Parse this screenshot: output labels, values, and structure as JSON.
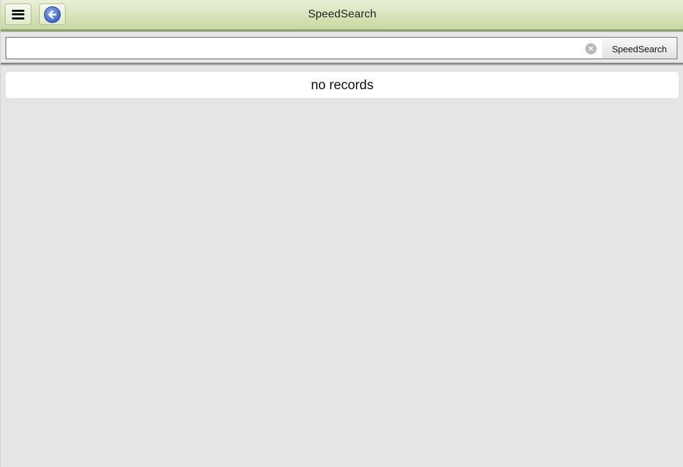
{
  "header": {
    "title": "SpeedSearch",
    "menu_icon": "hamburger-menu-icon",
    "back_icon": "back-arrow-icon",
    "accent_color": "#d7e3b8"
  },
  "search": {
    "value": "",
    "placeholder": "",
    "clear_icon": "clear-circle-icon",
    "clear_symbol": "×",
    "button_label": "SpeedSearch"
  },
  "results": {
    "message": "no records"
  }
}
